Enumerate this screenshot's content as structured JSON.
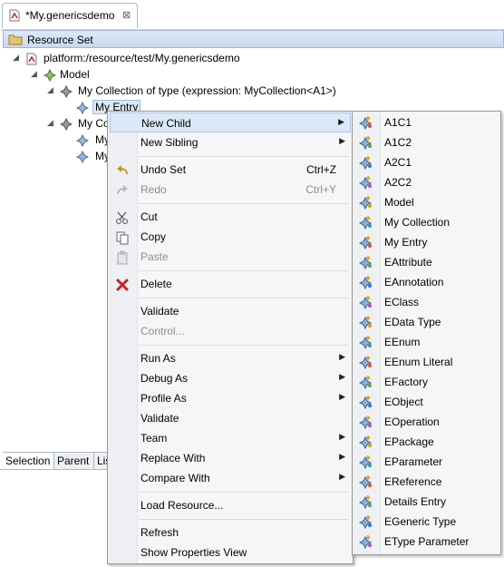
{
  "editor_tab": {
    "title": "*My.genericsdemo",
    "close": "⊠"
  },
  "viewer": {
    "header_label": "Resource Set"
  },
  "tree": {
    "root": "platform:/resource/test/My.genericsdemo",
    "model": "Model",
    "collection1": "My Collection of type (expression: MyCollection<A1>)",
    "entry_selected": "My Entry",
    "collection2_partial": "My Co",
    "entry2_partial": "My",
    "entry3_partial": "My"
  },
  "bottom_tabs": [
    "Selection",
    "Parent",
    "Lis"
  ],
  "context_menu": {
    "new_child": "New Child",
    "new_sibling": "New Sibling",
    "undo": "Undo Set",
    "undo_shortcut": "Ctrl+Z",
    "redo": "Redo",
    "redo_shortcut": "Ctrl+Y",
    "cut": "Cut",
    "copy": "Copy",
    "paste": "Paste",
    "delete": "Delete",
    "validate": "Validate",
    "control": "Control...",
    "run_as": "Run As",
    "debug_as": "Debug As",
    "profile_as": "Profile As",
    "validate2": "Validate",
    "team": "Team",
    "replace_with": "Replace With",
    "compare_with": "Compare With",
    "load_resource": "Load Resource...",
    "refresh": "Refresh",
    "show_properties": "Show Properties View"
  },
  "submenu_items": [
    "A1C1",
    "A1C2",
    "A2C1",
    "A2C2",
    "Model",
    "My Collection",
    "My Entry",
    "EAttribute",
    "EAnnotation",
    "EClass",
    "EData Type",
    "EEnum",
    "EEnum Literal",
    "EFactory",
    "EObject",
    "EOperation",
    "EPackage",
    "EParameter",
    "EReference",
    "Details Entry",
    "EGeneric Type",
    "EType Parameter"
  ],
  "colors": {
    "highlight": "#dbe8f7",
    "header": "#c9d9ee",
    "delete_red": "#cc2222"
  }
}
